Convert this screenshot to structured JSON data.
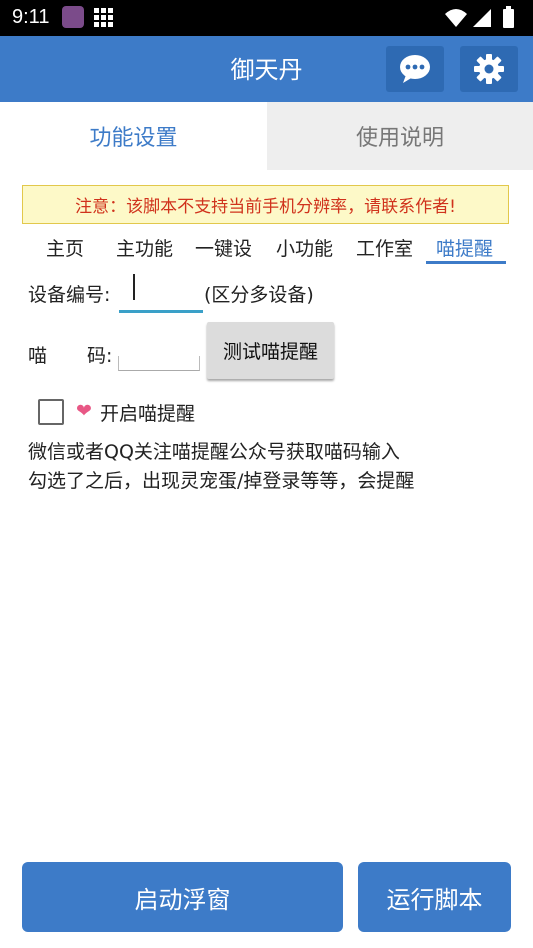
{
  "status_bar": {
    "time": "9:11"
  },
  "app_bar": {
    "title": "御天丹"
  },
  "tabs": [
    {
      "label": "功能设置"
    },
    {
      "label": "使用说明"
    }
  ],
  "notice": "注意：该脚本不支持当前手机分辨率，请联系作者!",
  "subtabs": [
    {
      "label": "主页"
    },
    {
      "label": "主功能"
    },
    {
      "label": "一键设"
    },
    {
      "label": "小功能"
    },
    {
      "label": "工作室"
    },
    {
      "label": "喵提醒"
    }
  ],
  "form": {
    "device_label": "设备编号:",
    "device_value": "",
    "device_hint": "(区分多设备)",
    "code_label_1": "喵",
    "code_label_2": "码:",
    "code_value": "",
    "test_button": "测试喵提醒",
    "enable_label": "开启喵提醒",
    "enable_checked": false
  },
  "description": {
    "line1": "微信或者QQ关注喵提醒公众号获取喵码输入",
    "line2": "勾选了之后，出现灵宠蛋/掉登录等等，会提醒"
  },
  "bottom_buttons": {
    "float_window": "启动浮窗",
    "run_script": "运行脚本"
  },
  "colors": {
    "primary": "#3d7bc8",
    "notice_text": "#d0321c",
    "notice_bg": "#fdf9c8"
  }
}
